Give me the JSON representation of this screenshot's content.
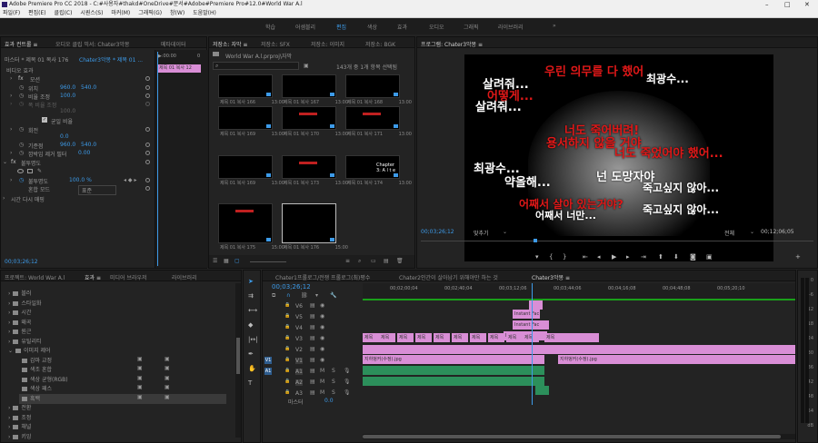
{
  "window": {
    "title": "Adobe Premiere Pro CC 2018 - C:#사용자#thakd#OneDrive#문서#Adobe#Premiere Pro#12.0#World War A.l",
    "min": "–",
    "max": "□",
    "close": "✕"
  },
  "menu": [
    "파일(F)",
    "편집(E)",
    "클립(C)",
    "시퀀스(S)",
    "마커(M)",
    "그래픽(G)",
    "창(W)",
    "도움말(H)"
  ],
  "workspaces": [
    "학습",
    "어셈블리",
    "편집",
    "색상",
    "효과",
    "오디오",
    "그래픽",
    "라이브러리"
  ],
  "workspaces_active": "편집",
  "workspaces_more": "»",
  "effect_controls": {
    "tabs": [
      "효과 컨트롤 ≡",
      "오디오 클립 믹서: Chater3악몽",
      "메타데이터"
    ],
    "master": "마스터 * 제목 01 복사 176",
    "clip": "Chater3악몽 * 제목 01 ...",
    "ruler_start": "▶:00:00",
    "ruler_end": "0",
    "clip_label": "제목 01 복사 12",
    "video_effects": "비디오 효과",
    "motion": "모션",
    "position_lbl": "위치",
    "position_x": "960.0",
    "position_y": "540.0",
    "scale_lbl": "비율 조정",
    "scale_v": "100.0",
    "scalew_lbl": "폭 비율 조정",
    "scalew_v": "100.0",
    "uniform_lbl": "균일 비율",
    "rotation_lbl": "회전",
    "rotation_v": "0.0",
    "anchor_lbl": "기준점",
    "anchor_x": "960.0",
    "anchor_y": "540.0",
    "flicker_lbl": "깜박임 제거 필터",
    "flicker_v": "0.00",
    "opacity": "불투명도",
    "opacity_lbl": "불투명도",
    "opacity_v": "100.0 %",
    "blend_lbl": "혼합 모드",
    "blend_v": "표준",
    "timeremap": "시간 다시 매핑",
    "timecode": "00;03;26;12"
  },
  "source": {
    "tabs": [
      "저장소: 자막 ≡",
      "저장소: SFX",
      "저장소: 이미지",
      "저장소: BGK"
    ],
    "path": "World War A.l.prproj\\자막",
    "count": "143개 중 1개 항목 선택됨",
    "thumbs": [
      {
        "cap": "제목 01 복사 166",
        "dur": "13:00"
      },
      {
        "cap": "제목 01 복사 167",
        "dur": "13:00"
      },
      {
        "cap": "제목 01 복사 168",
        "dur": "13:00"
      },
      {
        "cap": "제목 01 복사 169",
        "dur": "13:00"
      },
      {
        "cap": "제목 01 복사 170",
        "dur": "13:00"
      },
      {
        "cap": "제목 01 복사 171",
        "dur": "13:00"
      },
      {
        "cap": "제목 01 복사 169",
        "dur": "13:00"
      },
      {
        "cap": "제목 01 복사 173",
        "dur": "13:00"
      },
      {
        "cap": "제목 01 복사 174",
        "dur": "13:00"
      },
      {
        "cap": "제목 01 복사 175",
        "dur": "15:00"
      },
      {
        "cap": "제목 01 복사 176",
        "dur": "15:00"
      }
    ],
    "thumb_text": "Chapter 3: A l t e"
  },
  "program": {
    "tab": "프로그램: Chater3악몽 ≡",
    "timecode": "00;03;26;12",
    "fit": "맞추기",
    "full": "전체",
    "duration": "00;12;06;05",
    "subs": [
      {
        "t": "우린 의무를 다 했어",
        "c": "r"
      },
      {
        "t": "최광수...",
        "c": "w"
      },
      {
        "t": "살려줘...",
        "c": "w"
      },
      {
        "t": "어떻게...",
        "c": "r"
      },
      {
        "t": "살려줘...",
        "c": "w"
      },
      {
        "t": "너도 죽어버려!",
        "c": "r"
      },
      {
        "t": "용서하지 않을 거야",
        "c": "r"
      },
      {
        "t": "너도 죽었어야 했어...",
        "c": "r"
      },
      {
        "t": "최광수...",
        "c": "w"
      },
      {
        "t": "약올해...",
        "c": "w"
      },
      {
        "t": "넌 도망자야",
        "c": "w"
      },
      {
        "t": "죽고싶지 않아...",
        "c": "w"
      },
      {
        "t": "어째서 살아 있는거야?",
        "c": "r"
      },
      {
        "t": "어째서 너만...",
        "c": "w"
      },
      {
        "t": "죽고싶지 않아...",
        "c": "w"
      }
    ]
  },
  "project": {
    "tabs": [
      "프로젝트: World War A.l",
      "효과 ≡",
      "미디어 브라우저",
      "라이브러리"
    ],
    "items": [
      "블러",
      "스타일화",
      "시간",
      "왜곡",
      "원근",
      "유틸리티",
      "이미지 제어",
      "감마 교정",
      "색조 혼합",
      "색상 균형(RGB)",
      "색상 패스",
      "흑백",
      "전환",
      "조정",
      "채널",
      "키잉"
    ]
  },
  "timeline": {
    "tabs": [
      "Chater1프롤로그/전쟁 프롤로그(최)평수",
      "Chater2인간이 살아남기 위해야만 하는 것",
      "Chater3악몽 ≡"
    ],
    "timecode": "00;03;26;12",
    "ruler": [
      "00;00",
      "00;02;00;04",
      "00;02;40;04",
      "00;03;12;06",
      "00;03;44;06",
      "00;04;16;08",
      "00;04;48;08",
      "00;05;20;10"
    ],
    "tracks": [
      "V6",
      "V5",
      "V4",
      "V3",
      "V2",
      "V1",
      "A1",
      "A2",
      "A3"
    ],
    "master": "마스터",
    "master_v": "0.0",
    "clips_v1": [
      "지하벙커(수정).jpg",
      "지하벙커(수정).jpg"
    ],
    "clip_title": "제목",
    "clip_ins": "Instant Fac"
  },
  "meter": [
    "0",
    "-6",
    "-12",
    "-18",
    "-24",
    "-30",
    "-36",
    "-42",
    "-48",
    "-54",
    "dB"
  ]
}
